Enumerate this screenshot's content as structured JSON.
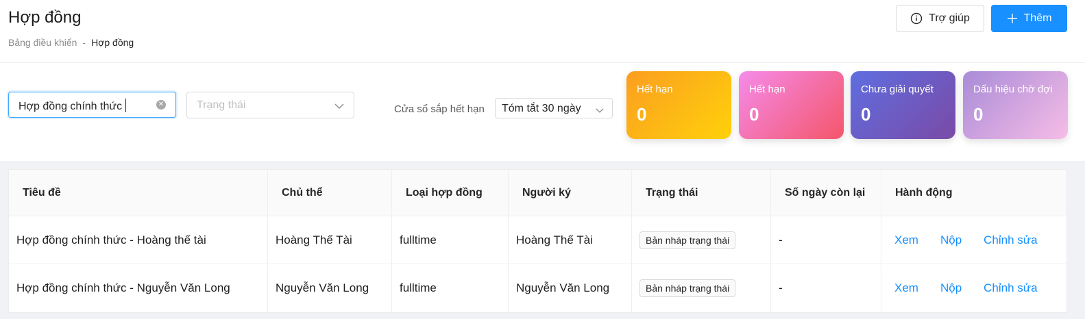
{
  "header": {
    "title": "Hợp đồng",
    "breadcrumb": {
      "root": "Bảng điều khiển",
      "separator": "-",
      "current": "Hợp đồng"
    },
    "help_label": "Trợ giúp",
    "add_label": "Thêm"
  },
  "filters": {
    "search_value": "Hợp đồng chính thức",
    "status_placeholder": "Trạng thái",
    "window_label": "Cửa sổ sắp hết hạn",
    "window_value": "Tóm tắt 30 ngày"
  },
  "stats": [
    {
      "label": "Hết hạn",
      "value": "0"
    },
    {
      "label": "Hết hạn",
      "value": "0"
    },
    {
      "label": "Chưa giải quyết",
      "value": "0"
    },
    {
      "label": "Dấu hiệu chờ đợi",
      "value": "0"
    }
  ],
  "table": {
    "columns": [
      "Tiêu đề",
      "Chủ thể",
      "Loại hợp đồng",
      "Người ký",
      "Trạng thái",
      "Số ngày còn lại",
      "Hành động"
    ],
    "rows": [
      {
        "title": "Hợp đồng chính thức - Hoàng thế tài",
        "subject": "Hoàng Thế Tài",
        "type": "fulltime",
        "signer": "Hoàng Thế Tài",
        "status": "Bản nháp trạng thái",
        "days_left": "-",
        "actions": [
          "Xem",
          "Nộp",
          "Chỉnh sửa"
        ]
      },
      {
        "title": "Hợp đồng chính thức - Nguyễn Văn Long",
        "subject": "Nguyễn Văn Long",
        "type": "fulltime",
        "signer": "Nguyễn Văn Long",
        "status": "Bản nháp trạng thái",
        "days_left": "-",
        "actions": [
          "Xem",
          "Nộp",
          "Chỉnh sửa"
        ]
      }
    ]
  },
  "colors": {
    "primary": "#1890ff",
    "card_expired_1": "#fb9e20",
    "card_expired_2": "#f4566a",
    "card_pending": "#5f6ee0",
    "card_waiting": "#a98bd8"
  },
  "icons": {
    "help": "info-circle-icon",
    "add": "plus-icon",
    "clear": "close-circle-icon",
    "dropdown": "chevron-down-icon"
  }
}
